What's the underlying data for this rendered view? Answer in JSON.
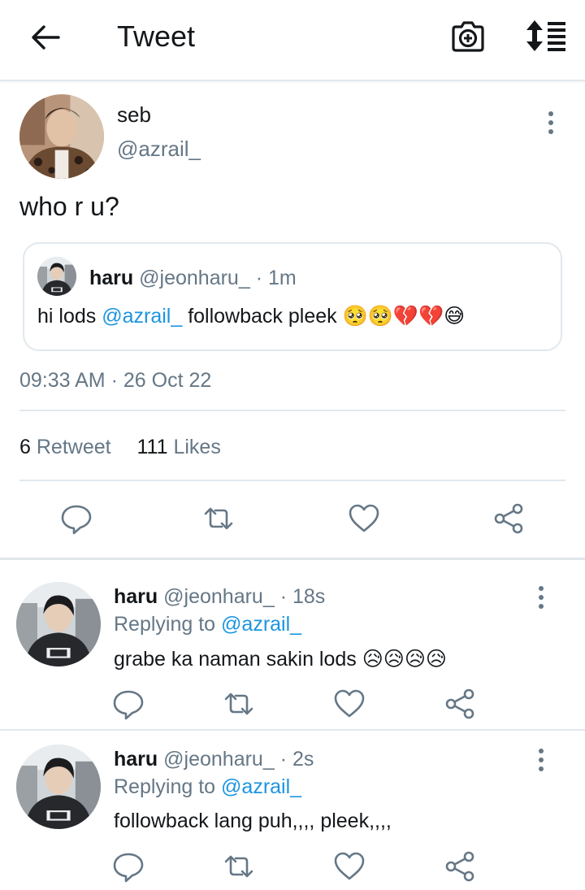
{
  "header": {
    "title": "Tweet"
  },
  "tweet": {
    "name": "seb",
    "handle": "@azrail_",
    "text": "who r u?",
    "quote": {
      "name": "haru",
      "handle": "@jeonharu_",
      "sep": "·",
      "time": "1m",
      "text_before": "hi lods ",
      "mention": "@azrail_",
      "text_after": " followback pleek ",
      "emojis": "🥺🥺💔💔😅"
    },
    "time": "09:33 AM",
    "sep": "·",
    "date": "26 Oct 22",
    "retweets_count": "6",
    "retweets_label": "Retweet",
    "likes_count": "111",
    "likes_label": "Likes"
  },
  "replies": [
    {
      "name": "haru",
      "handle": "@jeonharu_",
      "sep": "·",
      "time": "18s",
      "replying_label": "Replying to ",
      "replying_to": "@azrail_",
      "text": "grabe ka naman sakin lods ",
      "emojis": "😥😥😥😥"
    },
    {
      "name": "haru",
      "handle": "@jeonharu_",
      "sep": "·",
      "time": "2s",
      "replying_label": "Replying to ",
      "replying_to": "@azrail_",
      "text": "followback lang puh,,,, pleek,,,,",
      "emojis": ""
    }
  ],
  "icons": {
    "back": "arrow-left-icon",
    "camera": "camera-plus-icon",
    "sort": "sort-icon",
    "more": "more-vertical-icon",
    "reply": "comment-icon",
    "retweet": "retweet-icon",
    "like": "heart-icon",
    "share": "share-icon"
  },
  "colors": {
    "text": "#14171a",
    "muted": "#657786",
    "link": "#1b95e0",
    "divider": "#e1e8ed"
  }
}
